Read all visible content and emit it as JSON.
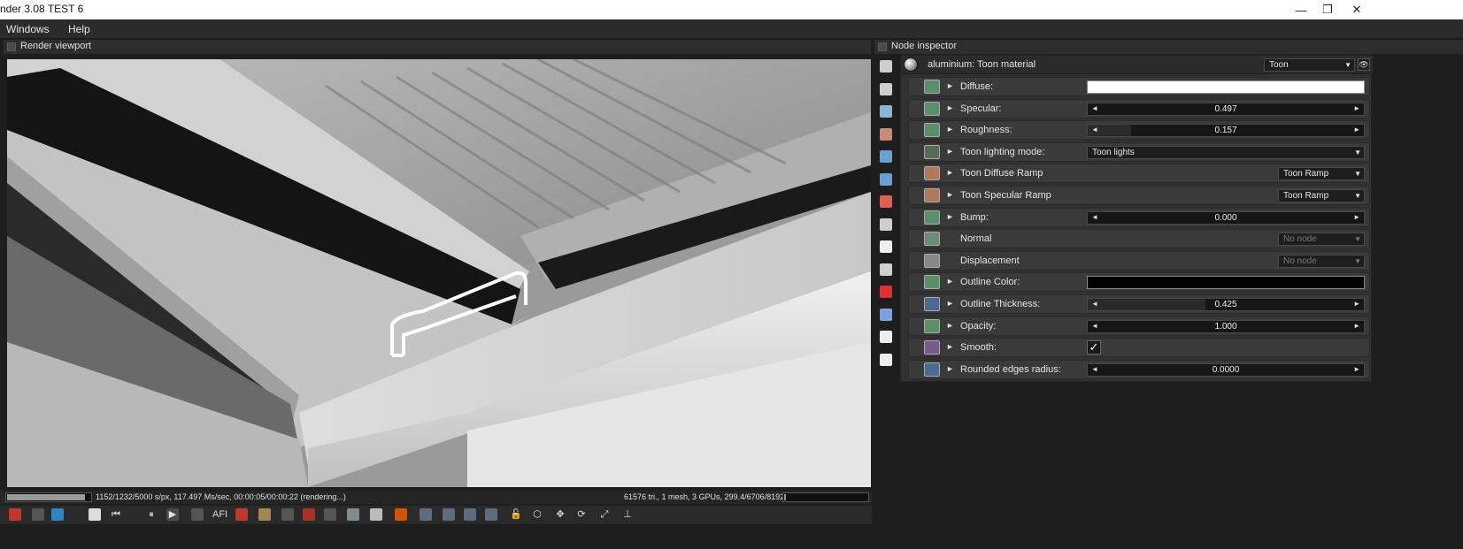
{
  "window": {
    "title": "nder 3.08 TEST 6",
    "minimize": "—",
    "maximize": "❐",
    "close": "✕"
  },
  "menu": [
    "Windows",
    "Help"
  ],
  "viewport": {
    "title": "Render viewport"
  },
  "status": {
    "left": "1152/1232/5000 s/px, 117.497 Ms/sec, 00:00:05/00:00:22 (rendering...)",
    "right": "61576 tri., 1 mesh, 3 GPUs, 299.4/6706/8192 MB",
    "progress": 0.94
  },
  "inspector": {
    "title": "Node inspector",
    "material": "aluminium: Toon material",
    "material_type": "Toon",
    "rows": [
      {
        "label": "Diffuse:",
        "kind": "color",
        "color": "#ffffff",
        "icon": "#5a8f6a",
        "arrow": "►"
      },
      {
        "label": "Specular:",
        "kind": "slider",
        "value": "0.497",
        "fill": 0.0,
        "icon": "#5a8f6a",
        "arrow": "►"
      },
      {
        "label": "Roughness:",
        "kind": "slider",
        "value": "0.157",
        "fill": 0.157,
        "icon": "#5a8f6a",
        "arrow": "►"
      },
      {
        "label": "Toon lighting mode:",
        "kind": "dropdown",
        "value": "Toon lights",
        "icon": "#5a6a5a",
        "arrow": "►"
      },
      {
        "label": "Toon Diffuse Ramp",
        "kind": "node",
        "value": "Toon Ramp",
        "icon": "#b07a5a",
        "arrow": "►"
      },
      {
        "label": "Toon Specular Ramp",
        "kind": "node",
        "value": "Toon Ramp",
        "icon": "#b07a5a",
        "arrow": "►"
      },
      {
        "label": "Bump:",
        "kind": "slider",
        "value": "0.000",
        "fill": 0.0,
        "icon": "#5a8f6a",
        "arrow": "►"
      },
      {
        "label": "Normal",
        "kind": "empty",
        "value": "No node",
        "icon": "#6f8a78",
        "arrow": ""
      },
      {
        "label": "Displacement",
        "kind": "empty",
        "value": "No node",
        "icon": "#888888",
        "arrow": ""
      },
      {
        "label": "Outline Color:",
        "kind": "color",
        "color": "#000000",
        "icon": "#5a8f6a",
        "arrow": "►"
      },
      {
        "label": "Outline Thickness:",
        "kind": "slider",
        "value": "0.425",
        "fill": 0.425,
        "icon": "#4a6a90",
        "arrow": "►"
      },
      {
        "label": "Opacity:",
        "kind": "slider",
        "value": "1.000",
        "fill": 0.0,
        "icon": "#5a8f6a",
        "arrow": "►"
      },
      {
        "label": "Smooth:",
        "kind": "check",
        "value": "✓",
        "icon": "#7a5a8a",
        "arrow": "►"
      },
      {
        "label": "Rounded edges radius:",
        "kind": "slider",
        "value": "0.0000",
        "fill": 0.0,
        "icon": "#4a6a90",
        "arrow": "►"
      }
    ]
  },
  "slider_arrows": {
    "left": "◄",
    "right": "►"
  },
  "dropdown_arrow": "▼",
  "eye_icon": "👁",
  "toolbar_icons": [
    {
      "name": "render-restart-icon",
      "color": "#c0392b",
      "glyph": ""
    },
    {
      "name": "region-icon",
      "color": "#555555",
      "glyph": ""
    },
    {
      "name": "cube-color-icon",
      "color": "#2e86c1",
      "glyph": ""
    },
    {
      "name": "stop-icon",
      "color": "#dddddd",
      "glyph": "■"
    },
    {
      "name": "rewind-icon",
      "color": "#2a2a2a",
      "glyph": "⏮"
    },
    {
      "name": "pause-icon",
      "color": "#2a2a2a",
      "glyph": "⏸"
    },
    {
      "name": "play-icon",
      "color": "#4a4a4a",
      "glyph": "▶"
    },
    {
      "name": "display-icon",
      "color": "#555555",
      "glyph": ""
    },
    {
      "name": "afi-icon",
      "color": "#2a2a2a",
      "glyph": "AFI"
    },
    {
      "name": "color-wheel-icon",
      "color": "#c0392b",
      "glyph": ""
    },
    {
      "name": "clay-icon",
      "color": "#a08850",
      "glyph": ""
    },
    {
      "name": "focus-pick-icon",
      "color": "#555555",
      "glyph": ""
    },
    {
      "name": "material-pick-icon",
      "color": "#a93226",
      "glyph": ""
    },
    {
      "name": "object-pick-icon",
      "color": "#555555",
      "glyph": ""
    },
    {
      "name": "camera-reset-icon",
      "color": "#7f8c8d",
      "glyph": ""
    },
    {
      "name": "white-square-icon",
      "color": "#bbbbbb",
      "glyph": ""
    },
    {
      "name": "spinner-icon",
      "color": "#d35400",
      "glyph": ""
    },
    {
      "name": "copy-icon",
      "color": "#5d6d7e",
      "glyph": ""
    },
    {
      "name": "export-icon",
      "color": "#5d6d7e",
      "glyph": ""
    },
    {
      "name": "save-image-icon",
      "color": "#5d6d7e",
      "glyph": ""
    },
    {
      "name": "layers-icon",
      "color": "#5d6d7e",
      "glyph": ""
    },
    {
      "name": "lock-icon",
      "color": "#2a2a2a",
      "glyph": "🔓"
    },
    {
      "name": "cube-outline-icon",
      "color": "#2a2a2a",
      "glyph": "⬡"
    },
    {
      "name": "move-icon",
      "color": "#2a2a2a",
      "glyph": "✥"
    },
    {
      "name": "rotate-icon",
      "color": "#2a2a2a",
      "glyph": "⟳"
    },
    {
      "name": "scale-icon",
      "color": "#2a2a2a",
      "glyph": "⤢"
    },
    {
      "name": "axis-icon",
      "color": "#2a2a2a",
      "glyph": "⊥"
    }
  ],
  "side_icons": [
    {
      "name": "graph-editor-icon",
      "color": "#cfcfcf"
    },
    {
      "name": "outliner-icon",
      "color": "#cfcfcf"
    },
    {
      "name": "imager-icon",
      "color": "#8ab4d8"
    },
    {
      "name": "camera-icon",
      "color": "#c98a7a"
    },
    {
      "name": "environment-icon",
      "color": "#6aa0d0"
    },
    {
      "name": "kernel-icon",
      "color": "#6aa0d0"
    },
    {
      "name": "material-icon",
      "color": "#e06050"
    },
    {
      "name": "film-icon",
      "color": "#cfcfcf"
    },
    {
      "name": "animation-clock-icon",
      "color": "#eeeeee"
    },
    {
      "name": "postprocess-icon",
      "color": "#cfcfcf"
    },
    {
      "name": "red-cube-icon",
      "color": "#e03030"
    },
    {
      "name": "blue-cube-icon",
      "color": "#7aa0e0"
    },
    {
      "name": "image-icon",
      "color": "#eeeeee"
    },
    {
      "name": "light-icon",
      "color": "#eeeeee"
    }
  ]
}
